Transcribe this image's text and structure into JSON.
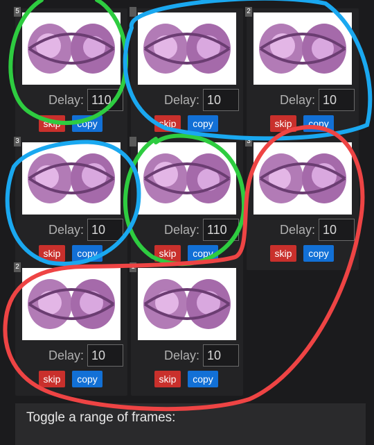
{
  "frames": [
    {
      "index_badge": "5",
      "delay_label": "Delay:",
      "delay_value": "110",
      "skip_label": "skip",
      "copy_label": "copy"
    },
    {
      "index_badge": "",
      "delay_label": "Delay:",
      "delay_value": "10",
      "skip_label": "skip",
      "copy_label": "copy"
    },
    {
      "index_badge": "2",
      "delay_label": "Delay:",
      "delay_value": "10",
      "skip_label": "skip",
      "copy_label": "copy"
    },
    {
      "index_badge": "3",
      "delay_label": "Delay:",
      "delay_value": "10",
      "skip_label": "skip",
      "copy_label": "copy"
    },
    {
      "index_badge": "",
      "delay_label": "Delay:",
      "delay_value": "110",
      "skip_label": "skip",
      "copy_label": "copy"
    },
    {
      "index_badge": "3",
      "delay_label": "Delay:",
      "delay_value": "10",
      "skip_label": "skip",
      "copy_label": "copy"
    },
    {
      "index_badge": "2",
      "delay_label": "Delay:",
      "delay_value": "10",
      "skip_label": "skip",
      "copy_label": "copy"
    },
    {
      "index_badge": "1",
      "delay_label": "Delay:",
      "delay_value": "10",
      "skip_label": "skip",
      "copy_label": "copy"
    }
  ],
  "range_panel": {
    "title": "Toggle a range of frames:"
  },
  "colors": {
    "background": "#1b1b1d",
    "skip_button": "#c9302c",
    "copy_button": "#1270d6",
    "annotation_green": "#2ecc40",
    "annotation_blue": "#1aa8f0",
    "annotation_red": "#ee4444"
  }
}
